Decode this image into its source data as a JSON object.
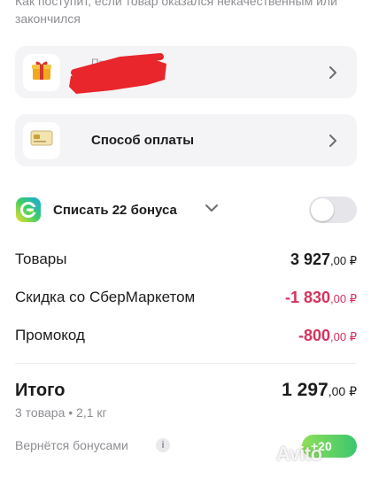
{
  "top_note": "Как поступит, если товар оказался некачественным или закончился",
  "promo_card": {
    "label": "Промокод",
    "icon": "gift-icon"
  },
  "payment_card": {
    "label": "Способ оплаты",
    "icon": "credit-card-icon"
  },
  "bonus": {
    "label": "Списать 22 бонуса",
    "icon": "sber-bonus-logo",
    "toggle_on": false
  },
  "summary": {
    "goods_label": "Товары",
    "goods_main": "3 927",
    "goods_kop": ",00 ₽",
    "discount_label": "Скидка со СберМаркетом",
    "discount_main": "-1 830",
    "discount_kop": ",00 ₽",
    "promo_label": "Промокод",
    "promo_main": "-800",
    "promo_kop": ",00 ₽"
  },
  "total": {
    "label": "Итого",
    "main": "1 297",
    "kop": ",00 ₽",
    "sub": "3 товара • 2,1 кг"
  },
  "returns": {
    "label": "Вернётся бонусами",
    "info": "i",
    "pill": "+20"
  },
  "watermark": "Avito",
  "colors": {
    "negative": "#d7305e",
    "card_bg": "#f4f4f6",
    "redaction": "#e8262c",
    "bonus_green": "#3cc66d"
  }
}
